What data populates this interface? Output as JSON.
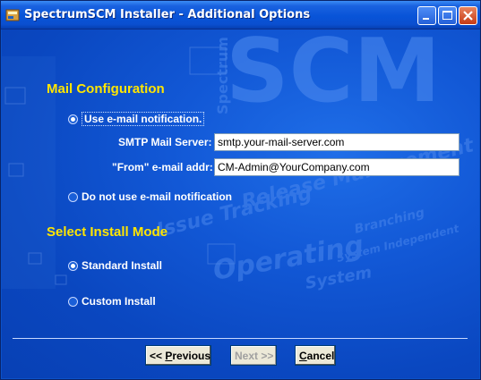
{
  "window": {
    "title": "SpectrumSCM Installer - Additional Options",
    "icons": {
      "app": "app-icon",
      "minimize": "minimize-icon",
      "maximize": "maximize-icon",
      "close": "close-icon"
    }
  },
  "background": {
    "logo": "SCM",
    "vertical_word": "Spectrum",
    "watermark_words": [
      "Release Management",
      "Issue Tracking",
      "Branching",
      "Operating",
      "System",
      "System Independent"
    ]
  },
  "mail_config": {
    "title": "Mail Configuration",
    "use_email_label": "Use e-mail notification.",
    "use_email_selected": true,
    "smtp_label": "SMTP Mail Server:",
    "smtp_value": "smtp.your-mail-server.com",
    "from_label": "\"From\" e-mail addr:",
    "from_value": "CM-Admin@YourCompany.com",
    "no_email_label": "Do not use e-mail notification",
    "no_email_selected": false
  },
  "install_mode": {
    "title": "Select Install Mode",
    "standard_label": "Standard Install",
    "standard_selected": true,
    "custom_label": "Custom Install",
    "custom_selected": false
  },
  "buttons": {
    "previous_prefix": "<< ",
    "previous_mnemonic": "P",
    "previous_rest": "revious",
    "next_label": "Next >>",
    "cancel_mnemonic": "C",
    "cancel_rest": "ancel"
  },
  "colors": {
    "background": "#0a51c8",
    "section_title": "#ffe600",
    "label": "#ffffff"
  }
}
